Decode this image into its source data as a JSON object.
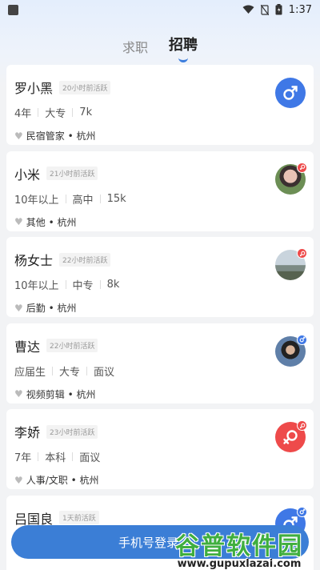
{
  "status_bar": {
    "time": "1:37",
    "icons": [
      "wifi-icon",
      "no-sim-icon",
      "battery-icon"
    ]
  },
  "tabs": [
    {
      "label": "求职",
      "active": false
    },
    {
      "label": "招聘",
      "active": true
    }
  ],
  "candidates": [
    {
      "name": "罗小黑",
      "active": "20小时前活跃",
      "experience": "4年",
      "education": "大专",
      "salary": "7k",
      "position": "民宿管家 • 杭州",
      "avatar": "male-icon"
    },
    {
      "name": "小米",
      "active": "21小时前活跃",
      "experience": "10年以上",
      "education": "高中",
      "salary": "15k",
      "position": "其他 • 杭州",
      "avatar": "photo",
      "badge": "female"
    },
    {
      "name": "杨女士",
      "active": "22小时前活跃",
      "experience": "10年以上",
      "education": "中专",
      "salary": "8k",
      "position": "后勤 • 杭州",
      "avatar": "photo",
      "badge": "female"
    },
    {
      "name": "曹达",
      "active": "22小时前活跃",
      "experience": "应届生",
      "education": "大专",
      "salary": "面议",
      "position": "视频剪辑 • 杭州",
      "avatar": "photo",
      "badge": "male"
    },
    {
      "name": "李娇",
      "active": "23小时前活跃",
      "experience": "7年",
      "education": "本科",
      "salary": "面议",
      "position": "人事/文职 • 杭州",
      "avatar": "female-icon",
      "badge": "female"
    },
    {
      "name": "吕国良",
      "active": "1天前活跃",
      "experience": "",
      "education": "",
      "salary": "",
      "position": "",
      "avatar": "male-icon",
      "badge": "male"
    }
  ],
  "login": {
    "label": "手机号登录"
  },
  "watermark": {
    "title": "谷普软件园",
    "url": "www.gupuxlazai.com"
  },
  "colors": {
    "accent": "#3b7ed6",
    "male": "#3f78e6",
    "female": "#ee4a4a"
  }
}
